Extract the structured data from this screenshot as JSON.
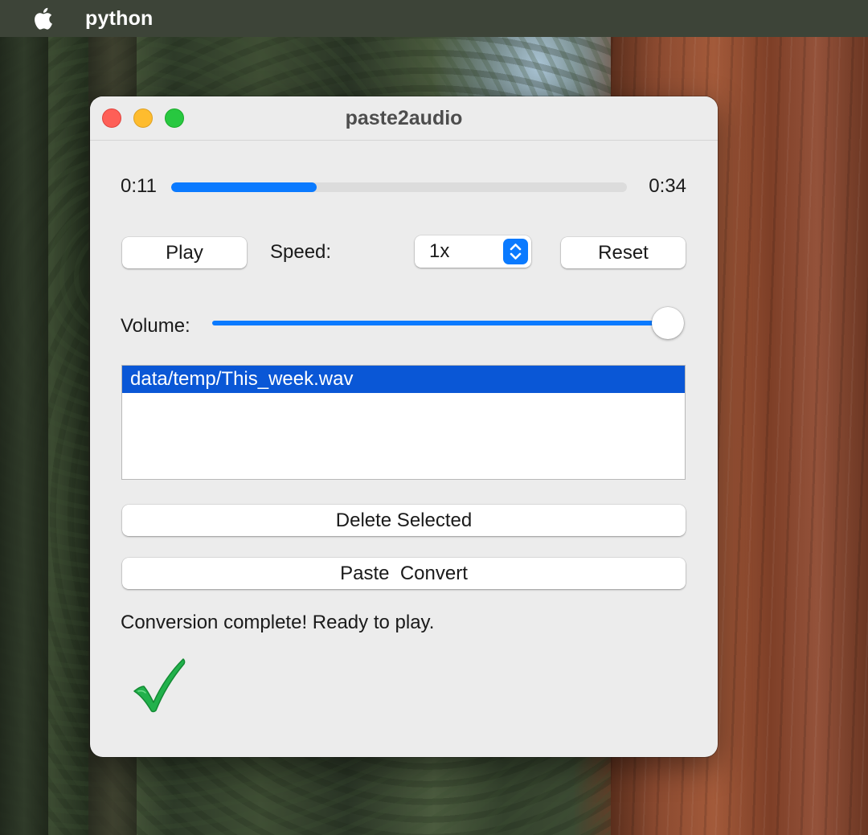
{
  "menubar": {
    "app_name": "python",
    "apple_icon": "apple-logo-icon"
  },
  "window": {
    "title": "paste2audio",
    "controls": [
      "close",
      "minimize",
      "zoom"
    ]
  },
  "playback": {
    "elapsed": "0:11",
    "total": "0:34",
    "progress_fraction": 0.32
  },
  "controls": {
    "play_label": "Play",
    "speed_label": "Speed:",
    "speed_value": "1x",
    "reset_label": "Reset"
  },
  "volume": {
    "label": "Volume:",
    "level_fraction": 1.0
  },
  "file_list": {
    "items": [
      "data/temp/This_week.wav"
    ],
    "selected_index": 0
  },
  "actions": {
    "delete_label": "Delete Selected",
    "convert_label": "Paste  Convert"
  },
  "status": {
    "message": "Conversion complete! Ready to play.",
    "icon": "green-checkmark-icon"
  },
  "colors": {
    "accent": "#0a7aff",
    "selection": "#0a57d6",
    "check": "#22b14c",
    "close": "#fe5f57",
    "minimize": "#febc2e",
    "zoom": "#28c840"
  }
}
